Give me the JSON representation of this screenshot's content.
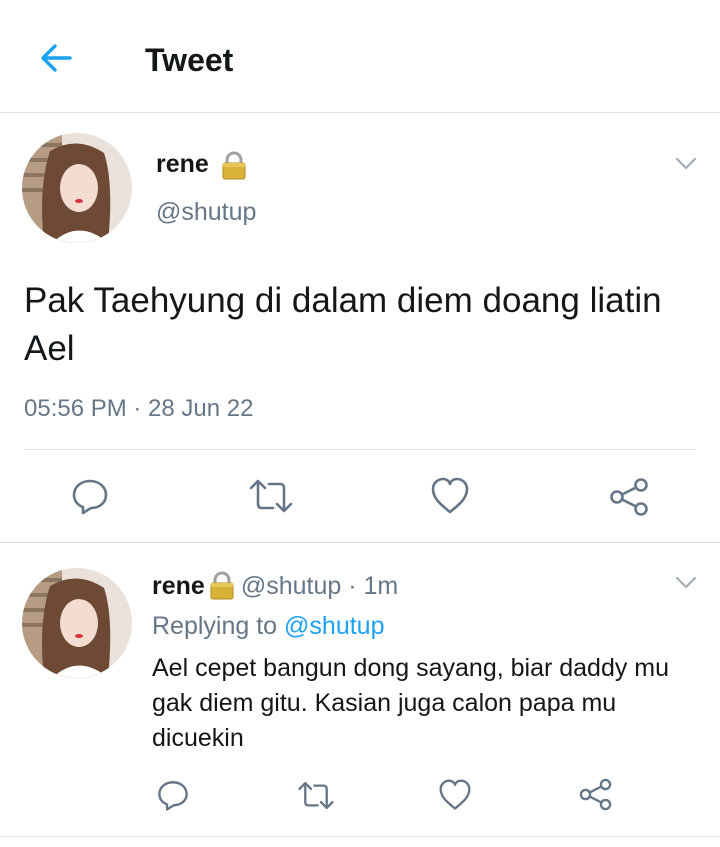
{
  "header": {
    "title": "Tweet",
    "back_icon": "arrow-left-icon"
  },
  "colors": {
    "accent": "#1da1f2",
    "secondary_text": "#657786",
    "icon_gray": "#657786"
  },
  "main_tweet": {
    "name": "rene",
    "handle": "@shutup",
    "text": "Pak Taehyung di dalam diem doang liatin Ael",
    "timestamp": "05:56 PM · 28 Jun 22"
  },
  "actions": [
    "reply-icon",
    "retweet-icon",
    "like-icon",
    "share-icon"
  ],
  "reply": {
    "name": "rene",
    "handle": "@shutup",
    "time": "1m",
    "replying_prefix": "Replying to",
    "replying_to": "@shutup",
    "text": "Ael cepet bangun dong sayang, biar daddy mu gak diem gitu. Kasian juga calon papa mu dicuekin"
  }
}
